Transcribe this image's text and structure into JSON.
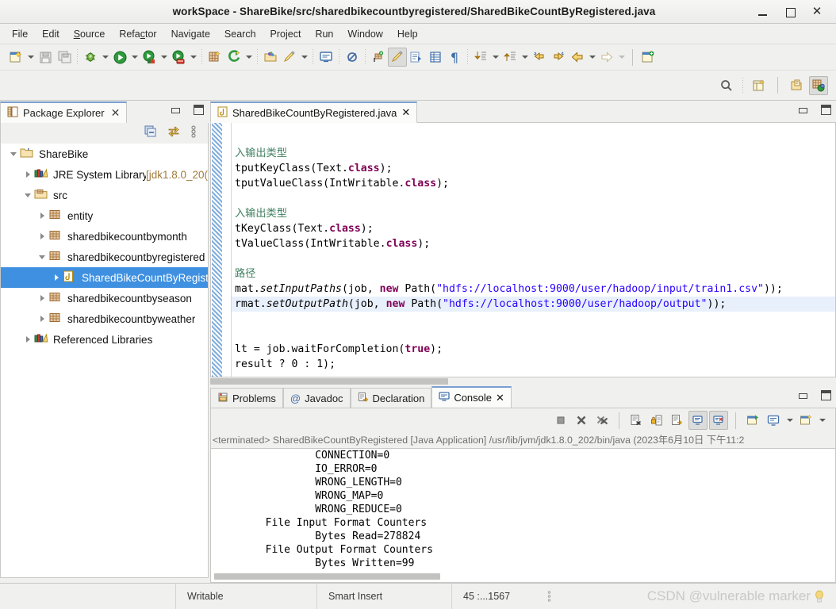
{
  "window": {
    "title": "workSpace - ShareBike/src/sharedbikecountbyregistered/SharedBikeCountByRegistered.java",
    "minimize_label": "minimize",
    "maximize_label": "maximize",
    "close_label": "✕"
  },
  "menu": {
    "items": [
      {
        "label": "File",
        "mnemonic": ""
      },
      {
        "label": "Edit",
        "mnemonic": ""
      },
      {
        "label": "Source",
        "mnemonic": "S"
      },
      {
        "label": "Refactor",
        "mnemonic": "c"
      },
      {
        "label": "Navigate",
        "mnemonic": ""
      },
      {
        "label": "Search",
        "mnemonic": ""
      },
      {
        "label": "Project",
        "mnemonic": ""
      },
      {
        "label": "Run",
        "mnemonic": ""
      },
      {
        "label": "Window",
        "mnemonic": ""
      },
      {
        "label": "Help",
        "mnemonic": ""
      }
    ]
  },
  "toolbar": {
    "buttons": [
      "new-wizard-icon",
      "new-wizard-dropdown",
      "save-icon",
      "save-all-icon",
      "debug-icon",
      "debug-dropdown",
      "run-icon",
      "run-dropdown",
      "coverage-icon",
      "coverage-dropdown",
      "run-last-tool-icon",
      "run-last-tool-dropdown",
      "new-java-project-icon",
      "external-tools-icon",
      "external-tools-dropdown",
      "open-type-icon",
      "search-icon2",
      "search-dropdown",
      "console-view-icon",
      "skip-breakpoints-icon",
      "new-package-icon",
      "toggle-mark-occurrences-icon",
      "link-editor-icon",
      "show-whitespace-icon",
      "pilcrow-icon",
      "next-annotation-icon",
      "next-annotation-dropdown",
      "previous-annotation-icon",
      "previous-annotation-dropdown",
      "last-edit-location-icon",
      "forward-edit-location-icon",
      "back-icon",
      "back-dropdown",
      "forward-icon",
      "forward-dropdown",
      "new-window-icon"
    ],
    "row2_buttons": [
      "quick-access-search-icon",
      "open-perspective-icon",
      "java-perspective-icon",
      "java-ee-perspective-icon"
    ]
  },
  "package_explorer": {
    "tab_label": "Package Explorer",
    "tab_icon": "package-explorer-icon",
    "close_icon": "✕",
    "toolbar": [
      "collapse-all-icon",
      "link-with-editor-icon",
      "view-menu-icon"
    ],
    "tree": [
      {
        "label": "ShareBike",
        "depth": 0,
        "twist": "open",
        "icon": "java-project-icon",
        "selected": false,
        "suffix": ""
      },
      {
        "label": "JRE System Library",
        "depth": 1,
        "twist": "closed",
        "icon": "library-icon",
        "selected": false,
        "suffix": " [jdk1.8.0_20("
      },
      {
        "label": "src",
        "depth": 1,
        "twist": "open",
        "icon": "source-folder-icon",
        "selected": false,
        "suffix": ""
      },
      {
        "label": "entity",
        "depth": 2,
        "twist": "closed",
        "icon": "package-icon",
        "selected": false,
        "suffix": ""
      },
      {
        "label": "sharedbikecountbymonth",
        "depth": 2,
        "twist": "closed",
        "icon": "package-icon",
        "selected": false,
        "suffix": ""
      },
      {
        "label": "sharedbikecountbyregistered",
        "depth": 2,
        "twist": "open",
        "icon": "package-icon",
        "selected": false,
        "suffix": ""
      },
      {
        "label": "SharedBikeCountByRegist",
        "depth": 3,
        "twist": "closed",
        "icon": "java-file-icon",
        "selected": true,
        "suffix": ""
      },
      {
        "label": "sharedbikecountbyseason",
        "depth": 2,
        "twist": "closed",
        "icon": "package-icon",
        "selected": false,
        "suffix": ""
      },
      {
        "label": "sharedbikecountbyweather",
        "depth": 2,
        "twist": "closed",
        "icon": "package-icon",
        "selected": false,
        "suffix": ""
      },
      {
        "label": "Referenced Libraries",
        "depth": 1,
        "twist": "closed",
        "icon": "library-icon",
        "selected": false,
        "suffix": ""
      }
    ]
  },
  "editor": {
    "tab_label": "SharedBikeCountByRegistered.java",
    "tab_icon": "java-file-icon",
    "close_icon": "✕",
    "minimize_label": "minimize",
    "maximize_label": "maximize",
    "lines": [
      {
        "highlight": false,
        "clipped": true,
        "parts": [
          {
            "t": "",
            "c": "plain"
          }
        ]
      },
      {
        "highlight": false,
        "parts": [
          {
            "t": "",
            "c": "plain"
          }
        ]
      },
      {
        "highlight": false,
        "parts": [
          {
            "t": "入输出类型",
            "c": "cm"
          }
        ]
      },
      {
        "highlight": false,
        "parts": [
          {
            "t": "tputKeyClass(Text.",
            "c": "plain"
          },
          {
            "t": "class",
            "c": "k"
          },
          {
            "t": ");",
            "c": "plain"
          }
        ]
      },
      {
        "highlight": false,
        "parts": [
          {
            "t": "tputValueClass(IntWritable.",
            "c": "plain"
          },
          {
            "t": "class",
            "c": "k"
          },
          {
            "t": ");",
            "c": "plain"
          }
        ]
      },
      {
        "highlight": false,
        "parts": [
          {
            "t": "",
            "c": "plain"
          }
        ]
      },
      {
        "highlight": false,
        "parts": [
          {
            "t": "入输出类型",
            "c": "cm"
          }
        ]
      },
      {
        "highlight": false,
        "parts": [
          {
            "t": "tKeyClass(Text.",
            "c": "plain"
          },
          {
            "t": "class",
            "c": "k"
          },
          {
            "t": ");",
            "c": "plain"
          }
        ]
      },
      {
        "highlight": false,
        "parts": [
          {
            "t": "tValueClass(IntWritable.",
            "c": "plain"
          },
          {
            "t": "class",
            "c": "k"
          },
          {
            "t": ");",
            "c": "plain"
          }
        ]
      },
      {
        "highlight": false,
        "parts": [
          {
            "t": "",
            "c": "plain"
          }
        ]
      },
      {
        "highlight": false,
        "parts": [
          {
            "t": "路径",
            "c": "cm"
          }
        ]
      },
      {
        "highlight": false,
        "parts": [
          {
            "t": "mat.",
            "c": "plain"
          },
          {
            "t": "setInputPaths",
            "c": "mi2"
          },
          {
            "t": "(job, ",
            "c": "plain"
          },
          {
            "t": "new",
            "c": "k"
          },
          {
            "t": " Path(",
            "c": "plain"
          },
          {
            "t": "\"hdfs://localhost:9000/user/hadoop/input/train1.csv\"",
            "c": "s"
          },
          {
            "t": "));",
            "c": "plain"
          }
        ]
      },
      {
        "highlight": true,
        "parts": [
          {
            "t": "rmat.",
            "c": "plain"
          },
          {
            "t": "setOutputPath",
            "c": "mi2"
          },
          {
            "t": "(job, ",
            "c": "plain"
          },
          {
            "t": "new",
            "c": "k"
          },
          {
            "t": " Path(",
            "c": "plain"
          },
          {
            "t": "\"hdfs://localhost:9000/user/hadoop/output\"",
            "c": "s"
          },
          {
            "t": "));",
            "c": "plain"
          }
        ]
      },
      {
        "highlight": false,
        "parts": [
          {
            "t": "",
            "c": "plain"
          }
        ]
      },
      {
        "highlight": false,
        "parts": [
          {
            "t": "",
            "c": "plain"
          }
        ]
      },
      {
        "highlight": false,
        "parts": [
          {
            "t": "lt = job.waitForCompletion(",
            "c": "plain"
          },
          {
            "t": "true",
            "c": "k"
          },
          {
            "t": ");",
            "c": "plain"
          }
        ]
      },
      {
        "highlight": false,
        "parts": [
          {
            "t": "result ? 0 : 1);",
            "c": "plain"
          }
        ]
      },
      {
        "highlight": false,
        "parts": [
          {
            "t": "",
            "c": "plain"
          }
        ]
      },
      {
        "highlight": false,
        "parts": [
          {
            "t": "",
            "c": "plain"
          }
        ]
      }
    ]
  },
  "bottom_panel": {
    "tabs": [
      {
        "label": "Problems",
        "icon": "problems-icon",
        "active": false,
        "closable": false
      },
      {
        "label": "Javadoc",
        "icon": "javadoc-icon",
        "active": false,
        "closable": false
      },
      {
        "label": "Declaration",
        "icon": "declaration-icon",
        "active": false,
        "closable": false
      },
      {
        "label": "Console",
        "icon": "console-icon",
        "active": true,
        "closable": true
      }
    ],
    "close_icon": "✕",
    "minimize_label": "minimize",
    "maximize_label": "maximize",
    "toolbar": [
      "terminate-icon",
      "remove-launch-icon",
      "remove-all-launches-icon",
      "clear-console-icon",
      "scroll-lock-icon",
      "word-wrap-icon",
      "show-console-on-output-icon",
      "show-console-on-error-icon",
      "pin-console-icon",
      "display-selected-console-icon",
      "display-console-dropdown",
      "open-console-icon",
      "open-console-dropdown"
    ],
    "console_header": "<terminated> SharedBikeCountByRegistered [Java Application] /usr/lib/jvm/jdk1.8.0_202/bin/java  (2023年6月10日  下午11:2",
    "console_output": [
      "                CONNECTION=0",
      "                IO_ERROR=0",
      "                WRONG_LENGTH=0",
      "                WRONG_MAP=0",
      "                WRONG_REDUCE=0",
      "        File Input Format Counters ",
      "                Bytes Read=278824",
      "        File Output Format Counters ",
      "                Bytes Written=99"
    ]
  },
  "status_bar": {
    "writable": "Writable",
    "insert_mode": "Smart Insert",
    "position": "45 :...1567",
    "watermark": "CSDN @vulnerable marker"
  },
  "colors": {
    "selection_blue": "#3f90e0",
    "tab_accent": "#7a9fd0",
    "keyword": "#7f0055",
    "string": "#2a00ff",
    "comment": "#3f7f5f",
    "line_highlight": "#e8f0fc",
    "chrome": "#f0f0ef"
  }
}
